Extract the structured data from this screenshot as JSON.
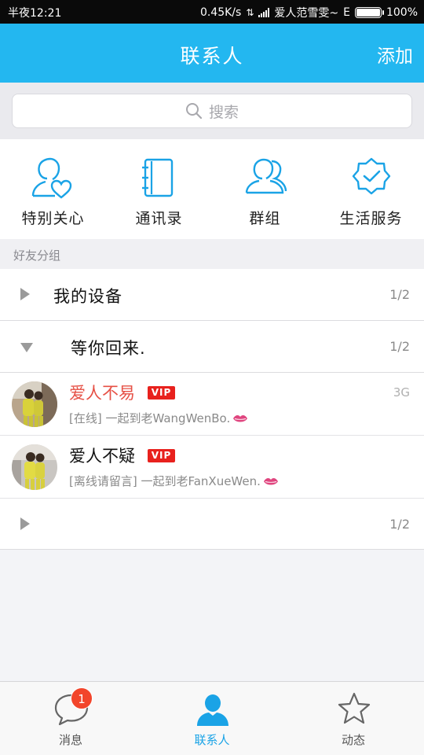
{
  "status_bar": {
    "time": "半夜12:21",
    "speed": "0.45K/s",
    "carrier": "爱人范雪雯~",
    "network": "E",
    "battery": "100%"
  },
  "header": {
    "title": "联系人",
    "add_label": "添加"
  },
  "search": {
    "placeholder": "搜索"
  },
  "quick_access": [
    {
      "label": "特别关心",
      "icon": "heart-person-icon"
    },
    {
      "label": "通讯录",
      "icon": "address-book-icon"
    },
    {
      "label": "群组",
      "icon": "group-icon"
    },
    {
      "label": "生活服务",
      "icon": "badge-check-icon"
    }
  ],
  "section": {
    "title": "好友分组"
  },
  "groups": [
    {
      "name": "我的设备",
      "count": "1/2",
      "expanded": false
    },
    {
      "name": "等你回来.",
      "count": "1/2",
      "expanded": true
    },
    {
      "name": "",
      "count": "1/2",
      "expanded": false
    }
  ],
  "contacts": [
    {
      "name": "爱人不易",
      "vip": "VIP",
      "network": "3G",
      "status": "[在线] 一起到老WangWenBo.",
      "highlight": true
    },
    {
      "name": "爱人不疑",
      "vip": "VIP",
      "network": "",
      "status": "[离线请留言] 一起到老FanXueWen.",
      "highlight": false
    }
  ],
  "bottom_nav": {
    "messages": {
      "label": "消息",
      "badge": "1"
    },
    "contacts": {
      "label": "联系人",
      "active": true
    },
    "moments": {
      "label": "动态"
    }
  },
  "colors": {
    "accent": "#23b7f0",
    "vip": "#e8211d",
    "badge": "#f2452b",
    "highlight_name": "#e65045"
  }
}
